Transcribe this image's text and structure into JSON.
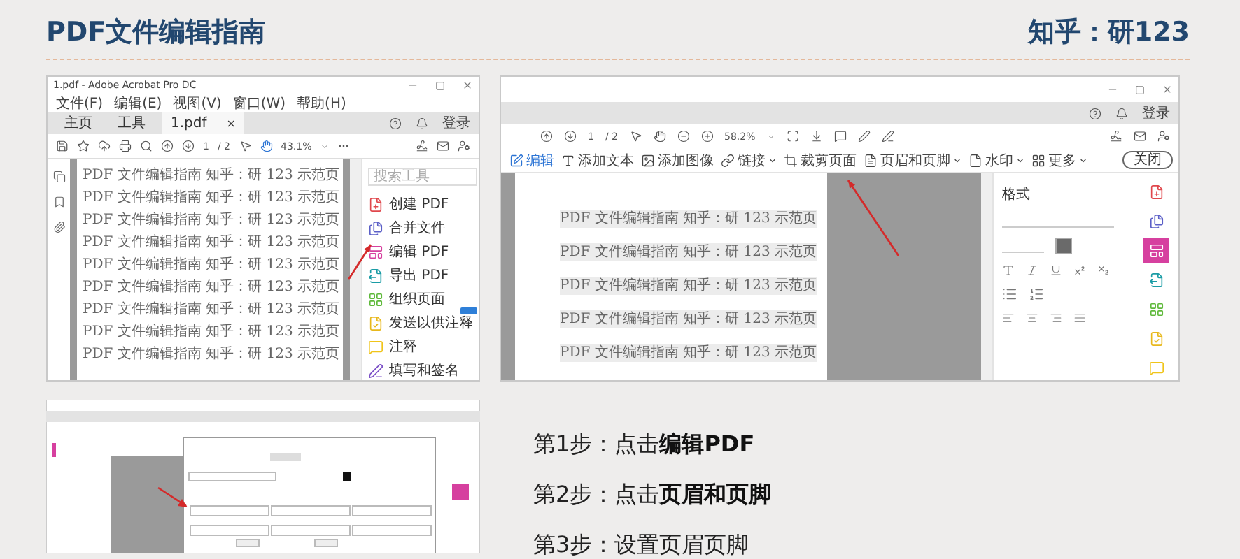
{
  "header": {
    "title": "PDF文件编辑指南",
    "account": "知乎：研123"
  },
  "window_1": {
    "title": "1.pdf - Adobe Acrobat Pro DC",
    "menu": [
      "文件(F)",
      "编辑(E)",
      "视图(V)",
      "窗口(W)",
      "帮助(H)"
    ],
    "tabs": [
      {
        "label": "主页",
        "selected": false
      },
      {
        "label": "工具",
        "selected": false
      },
      {
        "label": "1.pdf",
        "selected": true
      }
    ],
    "tab_close": "×",
    "sign_in": "登录",
    "page_current": "1",
    "page_total": "/ 2",
    "zoom": "43.1%",
    "page_lines": [
      "PDF 文件编辑指南 知乎：研 123 示范页",
      "PDF 文件编辑指南 知乎：研 123 示范页",
      "PDF 文件编辑指南 知乎：研 123 示范页",
      "PDF 文件编辑指南 知乎：研 123 示范页",
      "PDF 文件编辑指南 知乎：研 123 示范页",
      "PDF 文件编辑指南 知乎：研 123 示范页",
      "PDF 文件编辑指南 知乎：研 123 示范页",
      "PDF 文件编辑指南 知乎：研 123 示范页",
      "PDF 文件编辑指南 知乎：研 123 示范页"
    ],
    "search_placeholder": "搜索工具",
    "tools": [
      {
        "label": "创建 PDF",
        "color": "#e0474c",
        "badge": false
      },
      {
        "label": "合并文件",
        "color": "#5b5fc7",
        "badge": false
      },
      {
        "label": "编辑 PDF",
        "color": "#d6409f",
        "badge": false
      },
      {
        "label": "导出 PDF",
        "color": "#1a9ca5",
        "badge": false
      },
      {
        "label": "组织页面",
        "color": "#5fb93b",
        "badge": false
      },
      {
        "label": "发送以供注释",
        "color": "#e8b81c",
        "badge": true
      },
      {
        "label": "注释",
        "color": "#f0c419",
        "badge": false
      },
      {
        "label": "填写和签名",
        "color": "#7b4fc7",
        "badge": false
      }
    ]
  },
  "window_2": {
    "sign_in": "登录",
    "page_current": "1",
    "page_total": "/ 2",
    "zoom": "58.2%",
    "edit_tools": [
      {
        "label": "编辑",
        "selected": true,
        "dropdown": false
      },
      {
        "label": "添加文本",
        "selected": false,
        "dropdown": false
      },
      {
        "label": "添加图像",
        "selected": false,
        "dropdown": false
      },
      {
        "label": "链接",
        "selected": false,
        "dropdown": true
      },
      {
        "label": "裁剪页面",
        "selected": false,
        "dropdown": false
      },
      {
        "label": "页眉和页脚",
        "selected": false,
        "dropdown": true
      },
      {
        "label": "水印",
        "selected": false,
        "dropdown": true
      },
      {
        "label": "更多",
        "selected": false,
        "dropdown": true
      }
    ],
    "close": "关闭",
    "page_lines": [
      "PDF 文件编辑指南 知乎：研 123 示范页",
      "PDF 文件编辑指南 知乎：研 123 示范页",
      "PDF 文件编辑指南 知乎：研 123 示范页",
      "PDF 文件编辑指南 知乎：研 123 示范页",
      "PDF 文件编辑指南 知乎：研 123 示范页"
    ],
    "panel_title": "格式",
    "rail": [
      {
        "color": "#e0474c",
        "selected": false
      },
      {
        "color": "#5b5fc7",
        "selected": false
      },
      {
        "color": "#d6409f",
        "selected": true
      },
      {
        "color": "#1a9ca5",
        "selected": false
      },
      {
        "color": "#5fb93b",
        "selected": false
      },
      {
        "color": "#e8b81c",
        "selected": false
      },
      {
        "color": "#f0c419",
        "selected": false
      }
    ]
  },
  "steps": [
    "第1步：点击**编辑PDF**",
    "第2步：点击**页眉和页脚**",
    "第3步：设置页眉页脚"
  ]
}
